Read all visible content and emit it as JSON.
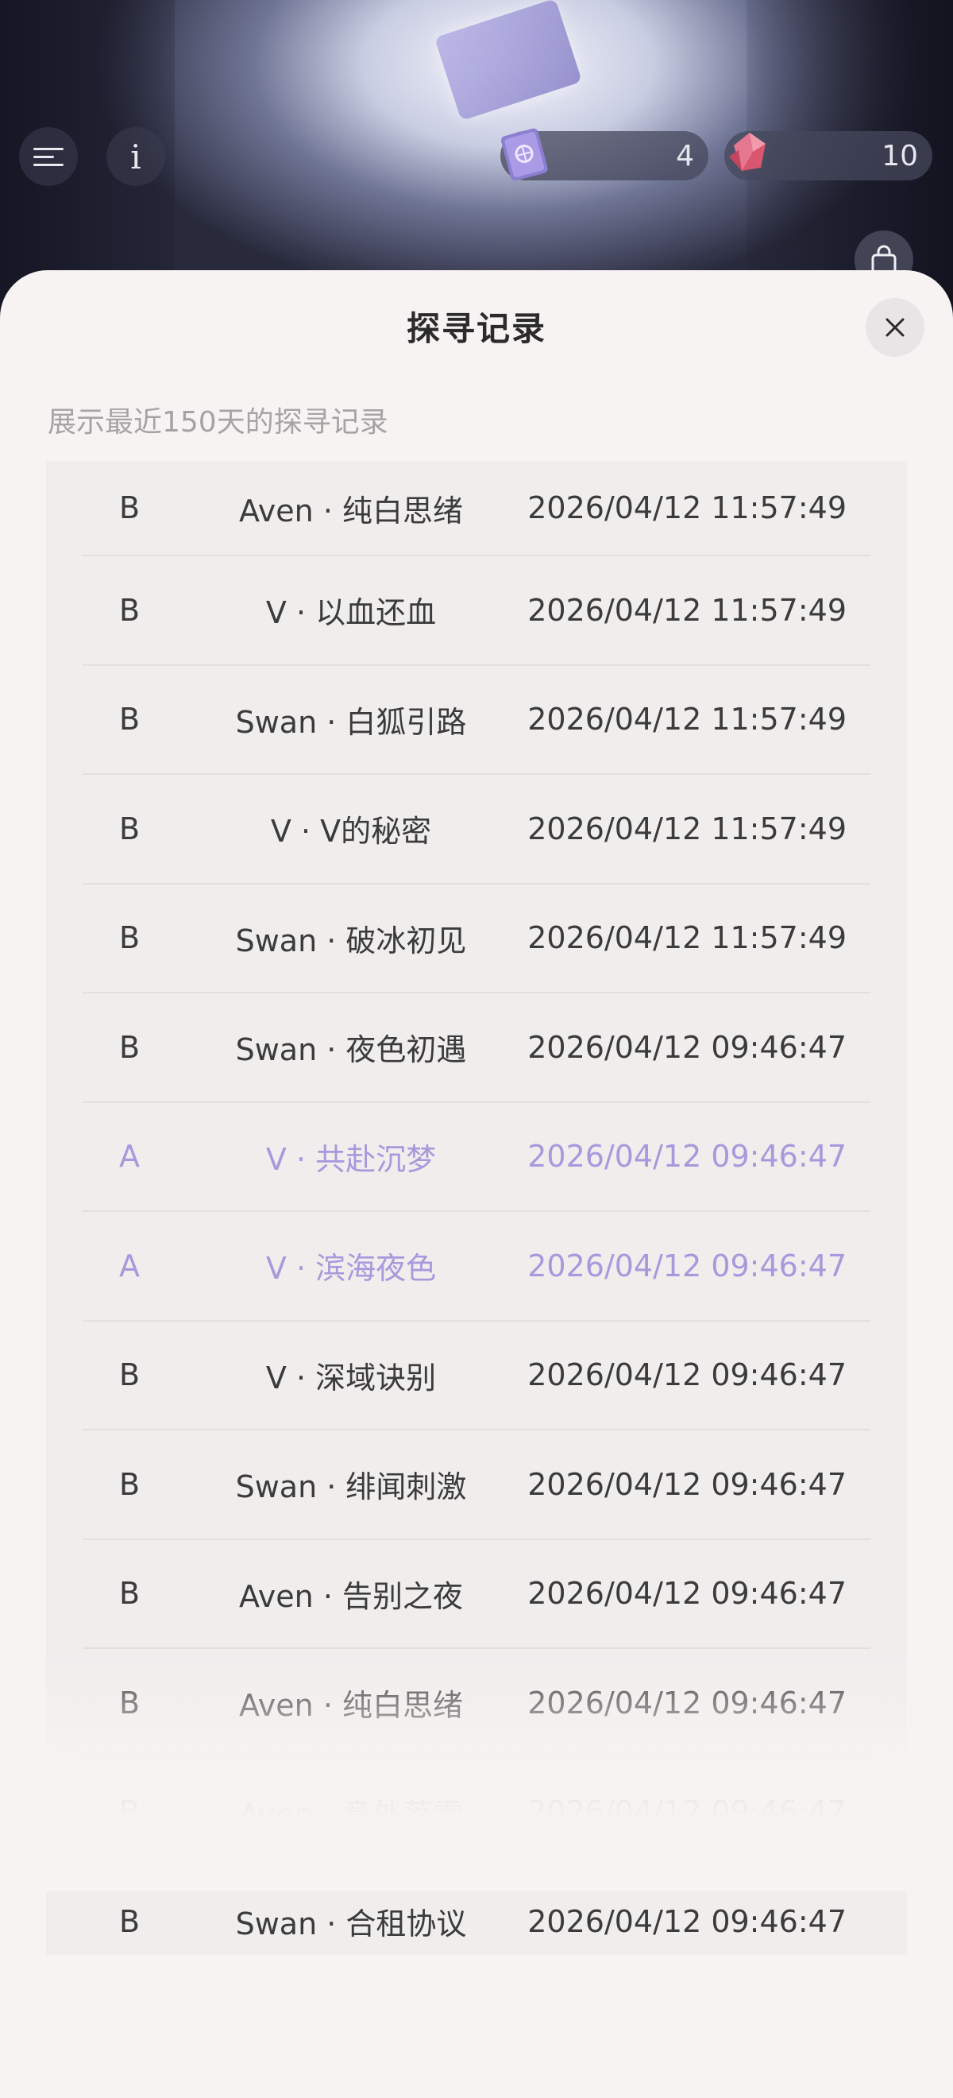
{
  "hud": {
    "currency1": {
      "value": "4",
      "icon": "book-ticket-icon",
      "color": "#8d7fd0"
    },
    "currency2": {
      "value": "10",
      "icon": "crystal-gem-icon",
      "color": "#e0677f"
    }
  },
  "modal": {
    "title": "探寻记录",
    "subtitle": "展示最近150天的探寻记录"
  },
  "records": [
    {
      "grade": "B",
      "name": "Aven · 纯白思绪",
      "time": "2026/04/12 11:57:49",
      "rare": false
    },
    {
      "grade": "B",
      "name": "V · 以血还血",
      "time": "2026/04/12 11:57:49",
      "rare": false
    },
    {
      "grade": "B",
      "name": "Swan · 白狐引路",
      "time": "2026/04/12 11:57:49",
      "rare": false
    },
    {
      "grade": "B",
      "name": "V · V的秘密",
      "time": "2026/04/12 11:57:49",
      "rare": false
    },
    {
      "grade": "B",
      "name": "Swan · 破冰初见",
      "time": "2026/04/12 11:57:49",
      "rare": false
    },
    {
      "grade": "B",
      "name": "Swan · 夜色初遇",
      "time": "2026/04/12 09:46:47",
      "rare": false
    },
    {
      "grade": "A",
      "name": "V · 共赴沉梦",
      "time": "2026/04/12 09:46:47",
      "rare": true
    },
    {
      "grade": "A",
      "name": "V · 滨海夜色",
      "time": "2026/04/12 09:46:47",
      "rare": true
    },
    {
      "grade": "B",
      "name": "V · 深域诀别",
      "time": "2026/04/12 09:46:47",
      "rare": false
    },
    {
      "grade": "B",
      "name": "Swan · 绯闻刺激",
      "time": "2026/04/12 09:46:47",
      "rare": false
    },
    {
      "grade": "B",
      "name": "Aven · 告别之夜",
      "time": "2026/04/12 09:46:47",
      "rare": false
    },
    {
      "grade": "B",
      "name": "Aven · 纯白思绪",
      "time": "2026/04/12 09:46:47",
      "rare": false
    },
    {
      "grade": "B",
      "name": "Aven · 意外落雪",
      "time": "2026/04/12 09:46:47",
      "rare": false
    },
    {
      "grade": "B",
      "name": "Swan · 合租协议",
      "time": "2026/04/12 09:46:47",
      "rare": false
    }
  ],
  "colors": {
    "rare_text": "#a799dc",
    "normal_text": "#3b3b3b",
    "sheet_bg": "#f7f3f3"
  }
}
